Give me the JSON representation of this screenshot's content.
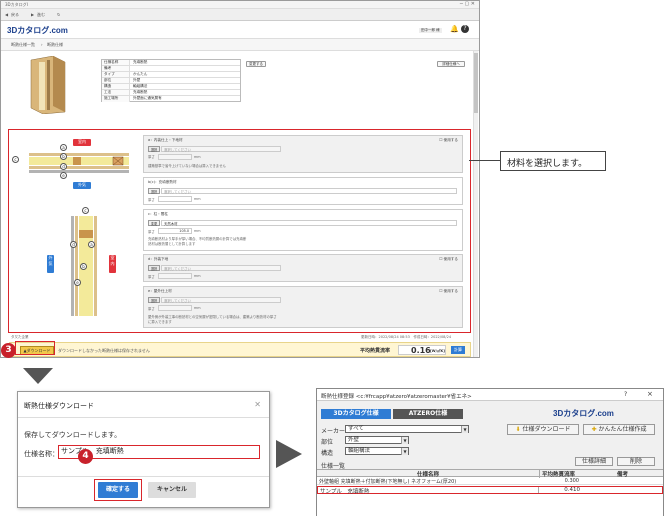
{
  "browser": {
    "title": "3DカタログI",
    "back_label": "戻る",
    "forward_label": "進む",
    "user": "田中一郎 様"
  },
  "header": {
    "logo": "3Dカタログ.com"
  },
  "crumbs": {
    "item1": "断熱仕様一覧",
    "item2": "断熱仕様"
  },
  "spec": {
    "rows": [
      {
        "k": "仕様名称",
        "v": "充填断熱"
      },
      {
        "k": "備考",
        "v": ""
      },
      {
        "k": "タイプ",
        "v": "かんたん"
      },
      {
        "k": "部位",
        "v": "外壁"
      },
      {
        "k": "構造",
        "v": "軸組構法"
      },
      {
        "k": "工法",
        "v": "充填断熱"
      },
      {
        "k": "施工場所",
        "v": "外壁面に通気層有"
      }
    ],
    "change_btn": "変更する",
    "detail_btn": "詳細仕様へ"
  },
  "diagram": {
    "inner_tag": "室内",
    "outer_tag": "外気",
    "plan_outer": "外気",
    "plan_inner": "室内",
    "labels": [
      "a",
      "b",
      "c",
      "d",
      "e"
    ]
  },
  "layers": [
    {
      "title": "a：内装仕上・下地材",
      "check": "使用する",
      "select_btn": "選択",
      "placeholder": "選択してください",
      "thickness_label": "厚さ",
      "unit": "mm",
      "note": "建築基準で省令上げていない場合は算入できません"
    },
    {
      "title": "b(c)：充填断熱材",
      "check": "",
      "select_btn": "選択",
      "placeholder": "選択してください",
      "thickness_label": "厚さ",
      "unit": "mm",
      "note": ""
    },
    {
      "title": "c：柱・間柱",
      "check": "",
      "select_btn": "変更",
      "value": "天然木材",
      "thickness_label": "厚さ",
      "thickness": "105.0",
      "unit": "mm",
      "note": "充填断熱材より厚手が厚い場合、不均質断熱層の計算では充填断熱材は断熱層として計算します"
    },
    {
      "title": "d：外装下地",
      "check": "使用する",
      "select_btn": "選択",
      "placeholder": "選択してください",
      "thickness_label": "厚さ",
      "unit": "mm",
      "note": ""
    },
    {
      "title": "e：屋外仕上材",
      "check": "使用する",
      "select_btn": "選択",
      "placeholder": "選択してください",
      "thickness_label": "厚さ",
      "unit": "mm",
      "note": "屋外側が外装工事の断熱材との空気層が密閉している場合は、建築より断熱材の厚さに算入できます"
    }
  ],
  "meta": {
    "left": "タ又た企業",
    "right": "更新日時：2022/08/24 08:53　作成日時：2022/08/24"
  },
  "footer": {
    "download_btn": "▲ダウンロード",
    "message": "ダウンロードしなかった断熱仕様は保存されません",
    "avg_label": "平均熱貫流率",
    "avg_value": "0.16",
    "avg_unit": "[W/㎡K]",
    "calc_btn": "計算"
  },
  "callout": {
    "text": "材料を選択します。"
  },
  "steps": {
    "s3": "3",
    "s4": "4"
  },
  "dialog": {
    "title": "断熱仕様ダウンロード",
    "message": "保存してダウンロードします。",
    "name_label": "仕様名称：",
    "name_value": "サンプル　充填断熱",
    "ok": "確定する",
    "cancel": "キャンセル"
  },
  "sub": {
    "title": "断熱仕様登録 <c:¥frcapp¥atzero¥atzeromaster¥省エネ>",
    "help": "?",
    "close": "×",
    "tab1": "3Dカタログ仕様",
    "tab2": "ATZERO仕様",
    "logo": "3Dカタログ.com",
    "maker_label": "メーカー",
    "maker_value": "すべて",
    "part_label": "部位",
    "part_value": "外壁",
    "struct_label": "構造",
    "struct_value": "軸組構法",
    "dl_btn": "仕様ダウンロード",
    "easy_btn": "かんたん仕様作成",
    "list_label": "仕様一覧",
    "detail_btn": "仕様詳細",
    "delete_btn": "削除",
    "cols": [
      "仕様名称",
      "平均熱貫流率",
      "備考"
    ],
    "rows": [
      {
        "name": "外壁軸組 充填断熱＋付加断熱(下地無し) ネオフォーム(厚20)",
        "value": "0.300",
        "note": ""
      },
      {
        "name": "サンプル　充填断熱",
        "value": "0.410",
        "note": ""
      }
    ]
  }
}
